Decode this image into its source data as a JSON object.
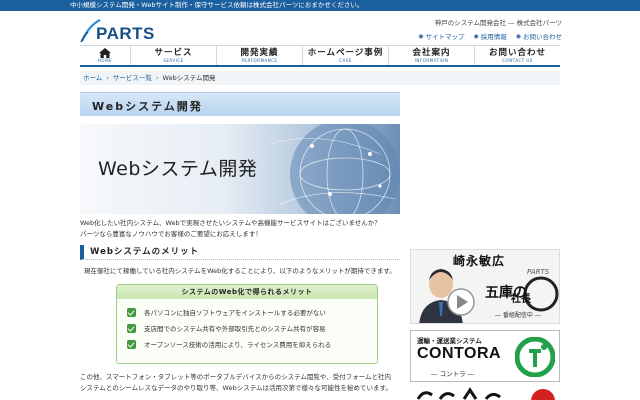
{
  "topbar": {
    "text": "中小規模システム開発・Webサイト制作・保守サービス依頼は株式会社パーツにおまかせください。"
  },
  "header": {
    "logo_text": "PARTS",
    "company": "神戸のシステム開発会社 ― 株式会社パーツ",
    "util_links": [
      {
        "label": "サイトマップ"
      },
      {
        "label": "採用情報"
      },
      {
        "label": "お問い合わせ"
      }
    ]
  },
  "nav": [
    {
      "jp": "",
      "en": "HOME"
    },
    {
      "jp": "サービス",
      "en": "SERVICE"
    },
    {
      "jp": "開発実績",
      "en": "PERFORMANCE"
    },
    {
      "jp": "ホームページ事例",
      "en": "CASE"
    },
    {
      "jp": "会社案内",
      "en": "INFORMATION"
    },
    {
      "jp": "お問い合わせ",
      "en": "CONTACT US"
    }
  ],
  "breadcrumb": {
    "home": "ホーム",
    "mid": "サービス一覧",
    "current": "Webシステム開発"
  },
  "page": {
    "title": "Webシステム開発",
    "hero_title": "Webシステム開発",
    "intro_line1": "Web化したい社内システム、Webで実現させたいシステムや高機能サービスサイトはございませんか？",
    "intro_line2": "パーツなら豊富なノウハウでお客様のご要望にお応えします！",
    "section_title": "Webシステムのメリット",
    "lead": "現在御社にて稼働している社内システムをWeb化することにより、以下のようなメリットが期待できます。",
    "merit_head": "システムのWeb化で得られるメリット",
    "merits": [
      "各パソコンに独自ソフトウェアをインストールする必要がない",
      "支店間でのシステム共有や外部取引先とのシステム共有が容易",
      "オープンソース技術の活用により、ライセンス費用を抑えられる"
    ],
    "para_line1": "この他、スマートフォン・タブレット等のポータブルデバイスからのシステム閲覧や、受付フォームと社内",
    "para_line2": "システムとのシームレスなデータのやり取り等、Webシステムは活用次第で様々な可能性を秘めています。"
  },
  "banners": {
    "b1_title": "崎永敏広",
    "b1_brand": "PARTS",
    "b1_main1": "五庫の",
    "b1_main2": "社長",
    "b1_sub": "― 番組配信中 ―",
    "b2_top": "運輸・運送業システム",
    "b2_main": "CONTORA",
    "b2_sub": "― コントラ ―"
  },
  "colors": {
    "brand": "#1b5f9e",
    "merit_green": "#3c9a3a"
  }
}
